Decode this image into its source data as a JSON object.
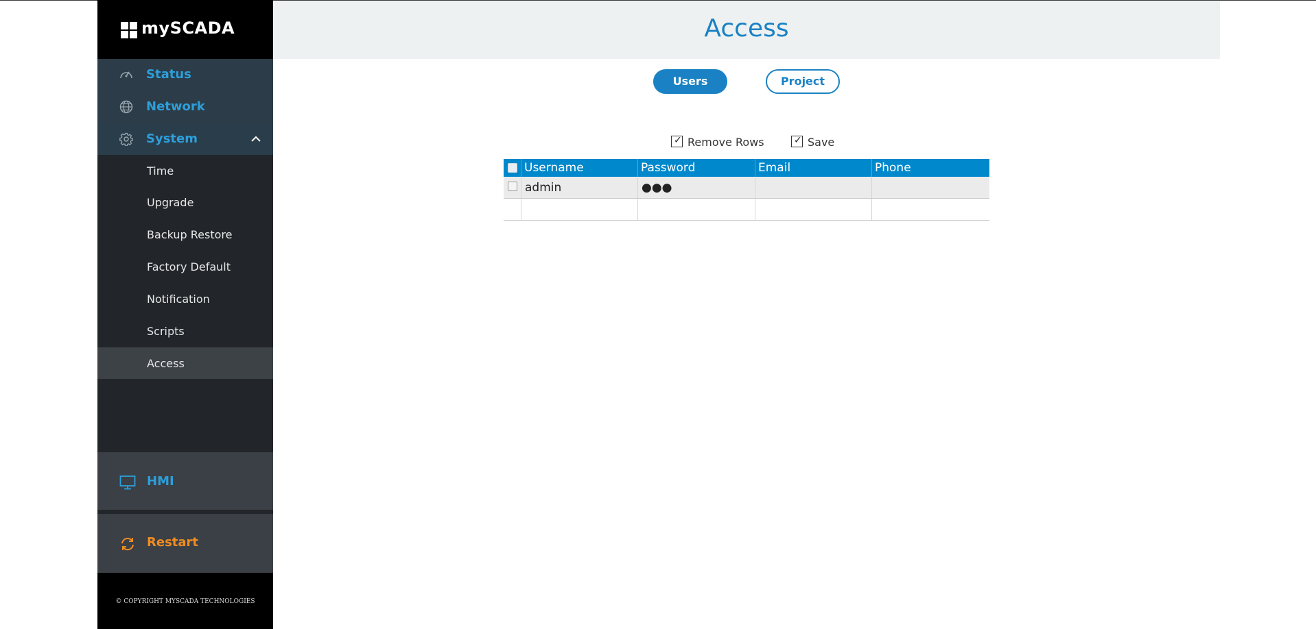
{
  "app": {
    "logo_text": "mySCADA"
  },
  "sidebar": {
    "nav": [
      {
        "label": "Status",
        "icon": "gauge-icon"
      },
      {
        "label": "Network",
        "icon": "globe-icon"
      },
      {
        "label": "System",
        "icon": "gear-icon",
        "expanded": true
      }
    ],
    "system_items": [
      {
        "label": "Time"
      },
      {
        "label": "Upgrade"
      },
      {
        "label": "Backup Restore"
      },
      {
        "label": "Factory Default"
      },
      {
        "label": "Notification"
      },
      {
        "label": "Scripts"
      },
      {
        "label": "Access",
        "active": true
      }
    ],
    "hmi_label": "HMI",
    "restart_label": "Restart",
    "copyright": "© COPYRIGHT MYSCADA TECHNOLOGIES"
  },
  "page": {
    "title": "Access"
  },
  "tabs": {
    "users": "Users",
    "project": "Project",
    "selected": "Users"
  },
  "actions": {
    "remove_rows": "Remove Rows",
    "save": "Save"
  },
  "table": {
    "columns": [
      "Username",
      "Password",
      "Email",
      "Phone"
    ],
    "rows": [
      {
        "username": "admin",
        "password": "●●●",
        "email": "",
        "phone": ""
      }
    ]
  },
  "colors": {
    "accent": "#1a82c4",
    "nav_text": "#2d9fda",
    "restart": "#f08c21",
    "table_header": "#0088cc"
  }
}
